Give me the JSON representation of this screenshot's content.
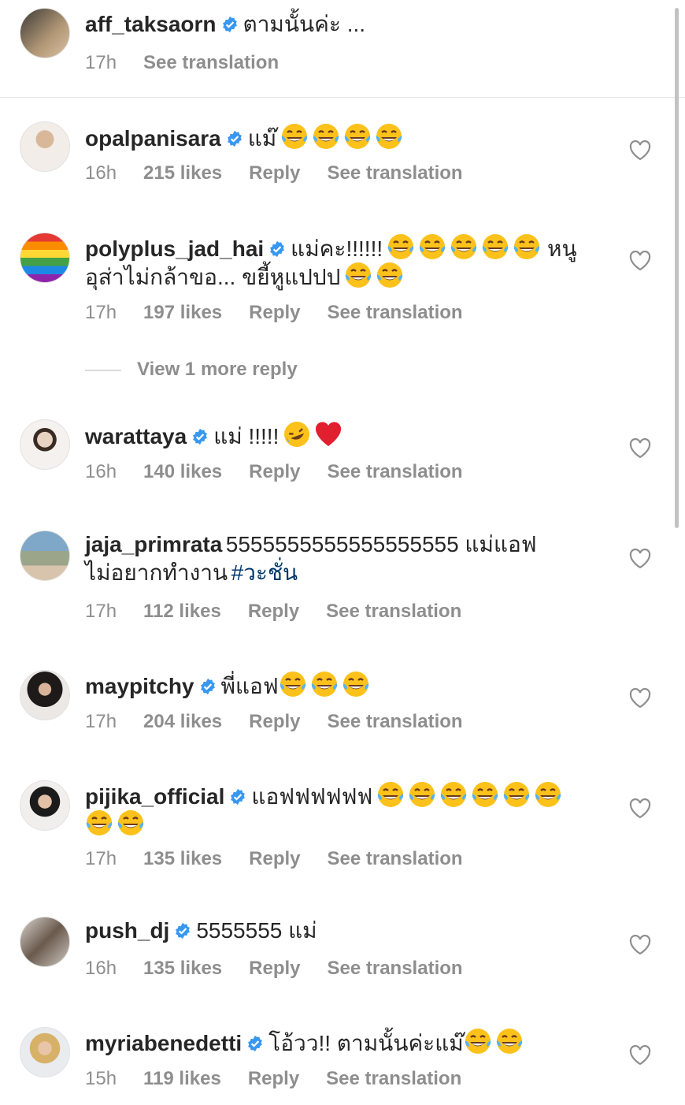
{
  "caption": {
    "username": "aff_taksaorn",
    "text": "ตามนั้นค่ะ ...",
    "time": "17h",
    "see_translation": "See translation"
  },
  "comments": [
    {
      "username": "opalpanisara",
      "text": "แม๊",
      "emoji_count": 4,
      "text2": "",
      "time": "16h",
      "likes": "215 likes",
      "reply": "Reply",
      "see_translation": "See translation"
    },
    {
      "username": "polyplus_jad_hai",
      "text": "แม่คะ!!!!!!",
      "emoji_count": 5,
      "text_after": "หนู",
      "line2": "อุส่าไม่กล้าขอ... ขยี้หูแปปป",
      "line2_emoji_count": 2,
      "time": "17h",
      "likes": "197 likes",
      "reply": "Reply",
      "see_translation": "See translation"
    },
    {
      "username": "warattaya",
      "text": "แม่ !!!!!",
      "time": "16h",
      "likes": "140 likes",
      "reply": "Reply",
      "see_translation": "See translation"
    },
    {
      "username": "jaja_primrata",
      "text": "5555555555555555555 แม่แอฟ",
      "line2": "ไม่อยากทำงาน",
      "hashtag": "#วะชั่น",
      "time": "17h",
      "likes": "112 likes",
      "reply": "Reply",
      "see_translation": "See translation"
    },
    {
      "username": "maypitchy",
      "text": "พี่แอฟ",
      "emoji_count": 3,
      "time": "17h",
      "likes": "204 likes",
      "reply": "Reply",
      "see_translation": "See translation"
    },
    {
      "username": "pijika_official",
      "text": "แอฟฟฟฟฟฟ",
      "emoji_count": 6,
      "line2_emoji_count": 2,
      "time": "17h",
      "likes": "135 likes",
      "reply": "Reply",
      "see_translation": "See translation"
    },
    {
      "username": "push_dj",
      "text": "5555555 แม่",
      "time": "16h",
      "likes": "135 likes",
      "reply": "Reply",
      "see_translation": "See translation"
    },
    {
      "username": "myriabenedetti",
      "text": "โอ้วว!! ตามนั้นค่ะแม๊",
      "emoji_count": 2,
      "time": "15h",
      "likes": "119 likes",
      "reply": "Reply",
      "see_translation": "See translation"
    }
  ],
  "view_more_reply": "View 1 more reply",
  "colors": {
    "verified": "#3897f0",
    "muted": "#8e8e8e",
    "text": "#262626",
    "hashtag": "#00376b",
    "heart_emoji": "#e0202e"
  }
}
